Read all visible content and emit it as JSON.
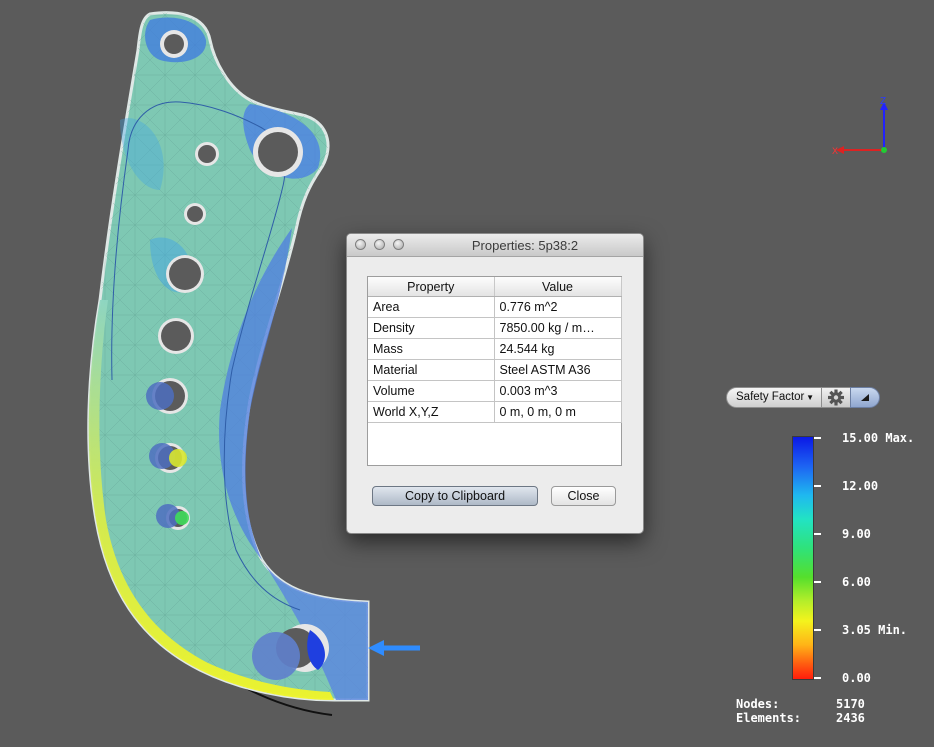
{
  "dialog": {
    "title": "Properties: 5p38:2",
    "columns": {
      "property": "Property",
      "value": "Value"
    },
    "rows": [
      {
        "property": "Area",
        "value": "0.776 m^2"
      },
      {
        "property": "Density",
        "value": "7850.00 kg / m…"
      },
      {
        "property": "Mass",
        "value": "24.544 kg"
      },
      {
        "property": "Material",
        "value": "Steel ASTM A36"
      },
      {
        "property": "Volume",
        "value": "0.003 m^3"
      },
      {
        "property": "World X,Y,Z",
        "value": "0 m, 0 m, 0 m"
      }
    ],
    "copy_button": "Copy to Clipboard",
    "close_button": "Close"
  },
  "toolbar": {
    "result_type": "Safety Factor",
    "gear_icon": "gear-icon",
    "expand_icon": "triangle-expand-icon"
  },
  "legend": {
    "labels": [
      "15.00 Max.",
      "12.00",
      "9.00",
      "6.00",
      "3.05 Min.",
      "0.00"
    ],
    "colors": {
      "max": "#0b19e6",
      "min": "#ff1d0c"
    }
  },
  "stats": {
    "nodes_label": "Nodes:",
    "nodes_value": "5170",
    "elements_label": "Elements:",
    "elements_value": "2436"
  },
  "axes": {
    "z_label": "Z",
    "x_label": "X"
  },
  "colors": {
    "background": "#5b5b5b",
    "part_fill": "#77c7b1",
    "load_arrow": "#2f8cff"
  }
}
